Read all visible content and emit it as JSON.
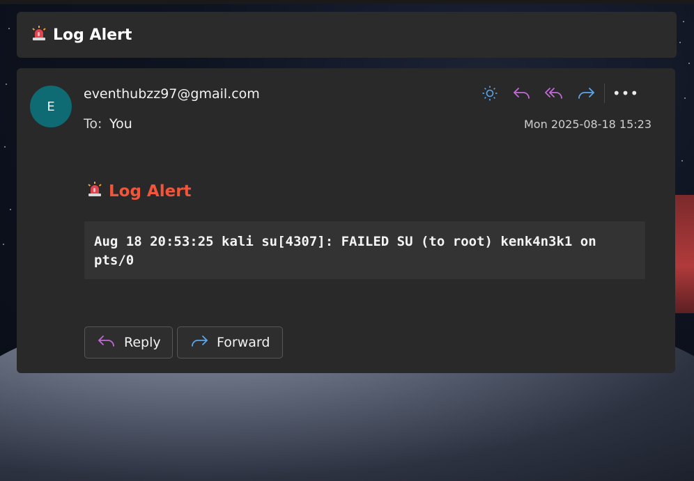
{
  "window": {
    "title": "Log Alert"
  },
  "message": {
    "avatar_initial": "E",
    "sender": "eventhubzz97@gmail.com",
    "to_label": "To:",
    "to_value": "You",
    "date": "Mon 2025-08-18 15:23",
    "body_title": "Log Alert",
    "log_text": "Aug 18 20:53:25 kali su[4307]: FAILED SU (to root) kenk4n3k1 on pts/0"
  },
  "toolbar": {
    "icons": [
      "sun-icon",
      "reply-icon",
      "reply-all-icon",
      "forward-icon",
      "more-icon"
    ],
    "more_glyph": "•••"
  },
  "buttons": {
    "reply_label": "Reply",
    "forward_label": "Forward"
  },
  "colors": {
    "accent_title": "#f2553a",
    "reply_icon": "#c26ad8",
    "forward_icon": "#5aa7ee",
    "avatar_bg": "#0f6b73",
    "sun_icon": "#5aa7ee"
  }
}
